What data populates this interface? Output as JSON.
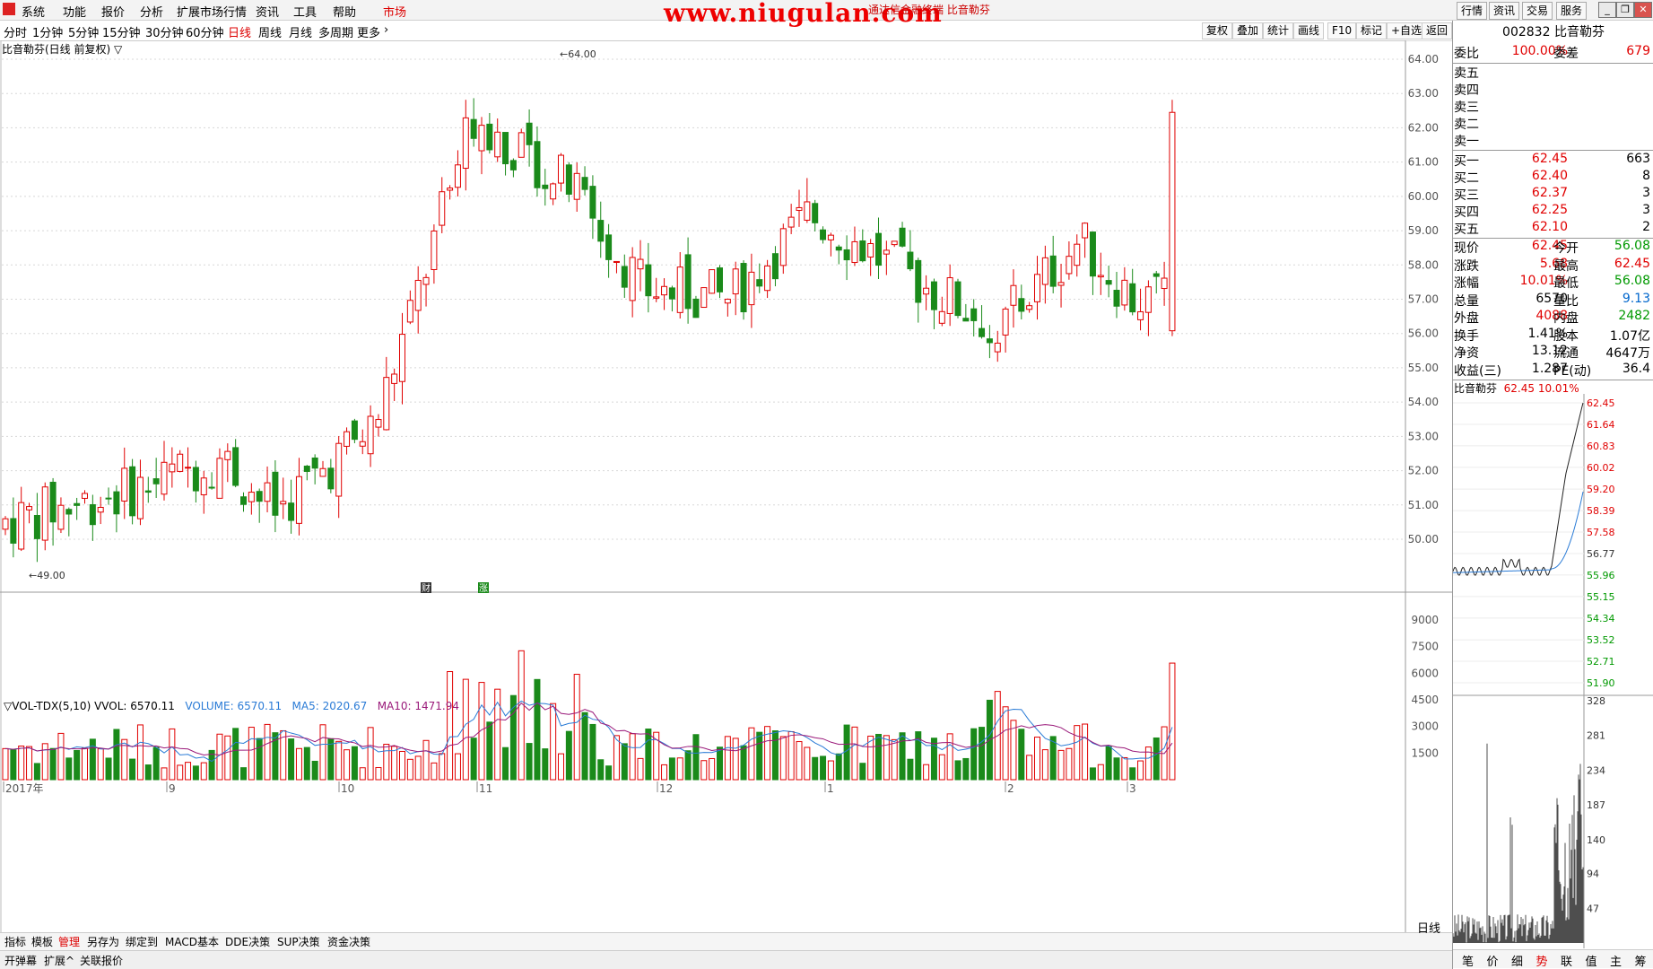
{
  "menubar": {
    "items": [
      "系统",
      "功能",
      "报价",
      "分析",
      "扩展市场行情",
      "资讯",
      "工具",
      "帮助",
      "市场"
    ],
    "watermark": "www.niugulan.com",
    "window_title": "通达信金融终端 比音勒芬",
    "right_buttons": [
      "行情",
      "资讯",
      "交易",
      "服务"
    ]
  },
  "periods": {
    "items": [
      "分时",
      "1分钟",
      "5分钟",
      "15分钟",
      "30分钟",
      "60分钟",
      "日线",
      "周线",
      "月线",
      "多周期",
      "更多"
    ],
    "tools": [
      "复权",
      "叠加",
      "统计",
      "画线",
      "F10",
      "标记",
      "+自选",
      "返回"
    ]
  },
  "chart": {
    "title": "比音勒芬(日线 前复权) ▽",
    "high_label": "64.00",
    "low_label": "49.00",
    "price_axis": [
      "64.00",
      "63.00",
      "62.00",
      "61.00",
      "60.00",
      "59.00",
      "58.00",
      "57.00",
      "56.00",
      "55.00",
      "54.00",
      "53.00",
      "52.00",
      "51.00",
      "50.00"
    ],
    "markers": [
      "财",
      "涨"
    ],
    "vol_legend": {
      "name": "▽VOL-TDX(5,10)",
      "vvol": "VVOL: 6570.11",
      "volume": "VOLUME: 6570.11",
      "ma5": "MA5: 2020.67",
      "ma10": "MA10: 1471.94"
    },
    "vol_axis": [
      "9000",
      "7500",
      "6000",
      "4500",
      "3000",
      "1500"
    ],
    "x_labels": [
      "2017年",
      "9",
      "10",
      "11",
      "12",
      "1",
      "2",
      "3"
    ],
    "period_label": "日线",
    "colors": {
      "up": "#e00000",
      "down": "#1a8a1a",
      "ma5": "#2a7bd6",
      "ma10": "#9a1a7a"
    }
  },
  "bottom_tabs": [
    "指标",
    "模板",
    "管理",
    "另存为",
    "绑定到",
    "MACD基本",
    "DDE决策",
    "SUP决策",
    "资金决策"
  ],
  "status_items": [
    "开弹幕",
    "扩展^",
    "关联报价"
  ],
  "quote": {
    "code_name": "002832 比音勒芬",
    "weibi_label": "委比",
    "weibi": "100.00%",
    "weicha_label": "委差",
    "weicha": "679",
    "sells": [
      "卖五",
      "卖四",
      "卖三",
      "卖二",
      "卖一"
    ],
    "buys": [
      {
        "label": "买一",
        "price": "62.45",
        "vol": "663"
      },
      {
        "label": "买二",
        "price": "62.40",
        "vol": "8"
      },
      {
        "label": "买三",
        "price": "62.37",
        "vol": "3"
      },
      {
        "label": "买四",
        "price": "62.25",
        "vol": "3"
      },
      {
        "label": "买五",
        "price": "62.10",
        "vol": "2"
      }
    ],
    "stats": [
      {
        "l1": "现价",
        "v1": "62.45",
        "c1": "red",
        "l2": "今开",
        "v2": "56.08",
        "c2": "green"
      },
      {
        "l1": "涨跌",
        "v1": "5.68",
        "c1": "red",
        "l2": "最高",
        "v2": "62.45",
        "c2": "red"
      },
      {
        "l1": "涨幅",
        "v1": "10.01%",
        "c1": "red",
        "l2": "最低",
        "v2": "56.08",
        "c2": "green"
      },
      {
        "l1": "总量",
        "v1": "6570",
        "c1": "",
        "l2": "量比",
        "v2": "9.13",
        "c2": "blue"
      },
      {
        "l1": "外盘",
        "v1": "4088",
        "c1": "red",
        "l2": "内盘",
        "v2": "2482",
        "c2": "green"
      },
      {
        "l1": "换手",
        "v1": "1.41%",
        "c1": "",
        "l2": "股本",
        "v2": "1.07亿",
        "c2": ""
      },
      {
        "l1": "净资",
        "v1": "13.12",
        "c1": "",
        "l2": "流通",
        "v2": "4647万",
        "c2": ""
      },
      {
        "l1": "收益(三)",
        "v1": "1.287",
        "c1": "",
        "l2": "PE(动)",
        "v2": "36.4",
        "c2": ""
      }
    ],
    "mini_title": "比音勒芬",
    "mini_price": "62.45",
    "mini_pct": "10.01%",
    "mini_price_axis": [
      "62.45",
      "61.64",
      "60.83",
      "60.02",
      "59.20",
      "58.39",
      "57.58",
      "56.77",
      "55.96",
      "55.15",
      "54.34",
      "53.52",
      "52.71",
      "51.90"
    ],
    "mini_vol_axis": [
      "328",
      "281",
      "234",
      "187",
      "140",
      "94",
      "47"
    ],
    "tabs": [
      "笔",
      "价",
      "细",
      "势",
      "联",
      "值",
      "主",
      "筹"
    ]
  }
}
